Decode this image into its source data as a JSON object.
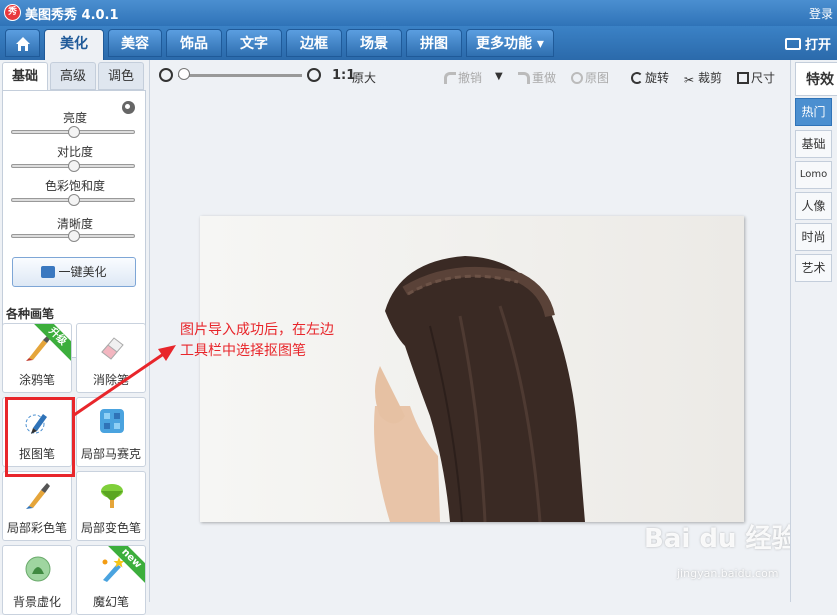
{
  "window": {
    "logo_text": "秀",
    "title": "美图秀秀 4.0.1",
    "login": "登录",
    "open": "打开"
  },
  "main_tabs": [
    {
      "label": "",
      "icon": "home-icon"
    },
    {
      "label": "美化",
      "active": true
    },
    {
      "label": "美容"
    },
    {
      "label": "饰品"
    },
    {
      "label": "文字"
    },
    {
      "label": "边框"
    },
    {
      "label": "场景"
    },
    {
      "label": "拼图"
    },
    {
      "label": "更多功能 ▾"
    }
  ],
  "left_panel": {
    "subtabs": [
      "基础",
      "高级",
      "调色"
    ],
    "sliders": [
      {
        "label": "亮度",
        "value": 0.5
      },
      {
        "label": "对比度",
        "value": 0.5
      },
      {
        "label": "色彩饱和度",
        "value": 0.5
      },
      {
        "label": "清晰度",
        "value": 0.5
      }
    ],
    "one_key_button": "一键美化",
    "section_title": "各种画笔",
    "tools": [
      {
        "label": "涂鸦笔",
        "badge": "升级",
        "icon": "brush-icon"
      },
      {
        "label": "消除笔",
        "icon": "eraser-icon"
      },
      {
        "label": "抠图笔",
        "icon": "pen-tool-icon"
      },
      {
        "label": "局部马赛克",
        "icon": "mosaic-icon"
      },
      {
        "label": "局部彩色笔",
        "icon": "color-brush-icon"
      },
      {
        "label": "局部变色笔",
        "icon": "paint-bucket-icon"
      },
      {
        "label": "背景虚化",
        "icon": "blur-icon"
      },
      {
        "label": "魔幻笔",
        "badge": "new",
        "icon": "magic-wand-icon"
      }
    ]
  },
  "canvas_toolbar": {
    "zoom_ratio": "1:1",
    "original_size": "原大",
    "undo": "撤销",
    "redo": "重做",
    "original": "原图",
    "rotate": "旋转",
    "crop": "裁剪",
    "resize": "尺寸"
  },
  "annotation": {
    "line1": "图片导入成功后，在左边",
    "line2": "工具栏中选择抠图笔"
  },
  "watermark": {
    "main": "Bai du 经验",
    "sub": "jingyan.baidu.com"
  },
  "right_panel": {
    "header": "特效",
    "categories": [
      "热门",
      "基础",
      "Lomo",
      "人像",
      "时尚",
      "艺术"
    ],
    "active_category": "热门"
  },
  "colors": {
    "accent": "#2f73b8",
    "highlight_red": "#e8262b",
    "badge_green": "#3cae3c"
  }
}
